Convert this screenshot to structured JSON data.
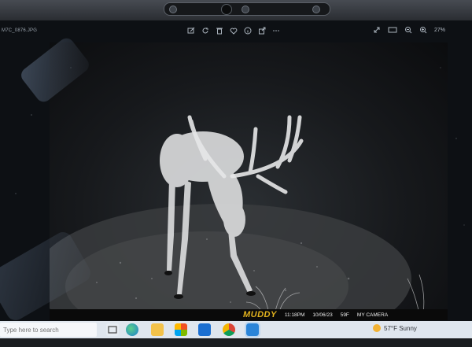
{
  "viewer": {
    "filename": "M7C_0876.JPG",
    "zoom": "27%",
    "toolbar_icons": [
      "edit-icon",
      "rotate-icon",
      "delete-icon",
      "favorite-icon",
      "info-icon",
      "share-icon"
    ],
    "right_icons": [
      "expand-icon",
      "slideshow-icon",
      "zoom-out-icon",
      "zoom-in-icon"
    ]
  },
  "photo": {
    "brand": "MUDDY",
    "time": "11:18PM",
    "date": "10/06/23",
    "temperature": "59F",
    "camera": "MY CAMERA"
  },
  "taskbar": {
    "search_placeholder": "Type here to search",
    "weather": "57°F Sunny",
    "apps": [
      "edge-icon",
      "file-explorer-icon",
      "store-icon",
      "mail-icon",
      "chrome-icon",
      "photos-icon"
    ]
  }
}
